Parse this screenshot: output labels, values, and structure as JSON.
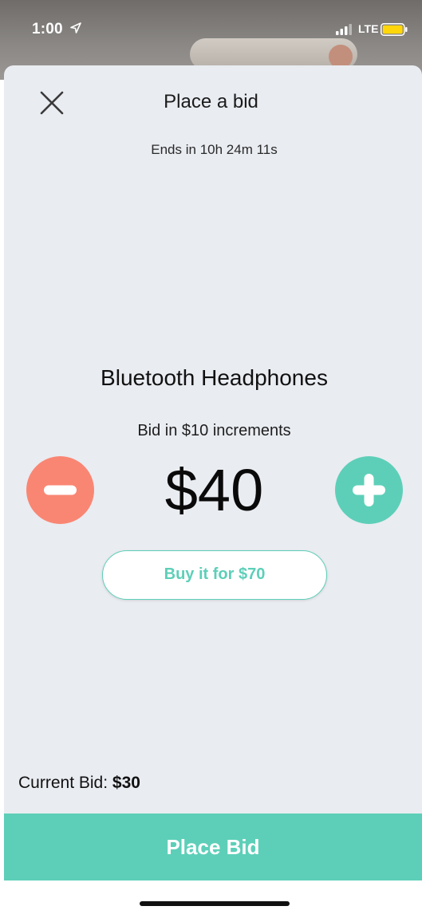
{
  "status_bar": {
    "time": "1:00",
    "network": "LTE"
  },
  "sheet": {
    "title": "Place a bid",
    "ends_in": "Ends in 10h 24m 11s"
  },
  "item": {
    "name": "Bluetooth Headphones",
    "increment_note": "Bid in $10 increments"
  },
  "bid": {
    "amount": "$40",
    "buy_now_label": "Buy it for $70"
  },
  "current_bid": {
    "label": "Current Bid:",
    "value": "$30"
  },
  "actions": {
    "place_bid_label": "Place Bid"
  },
  "colors": {
    "accent": "#5dcfb8",
    "decrease": "#f98673",
    "sheet_background": "#e9ecf1"
  },
  "icons": {
    "close": "close-icon",
    "minus": "minus-icon",
    "plus": "plus-icon",
    "location": "location-arrow-icon",
    "signal": "cellular-signal-icon",
    "battery": "battery-icon"
  }
}
